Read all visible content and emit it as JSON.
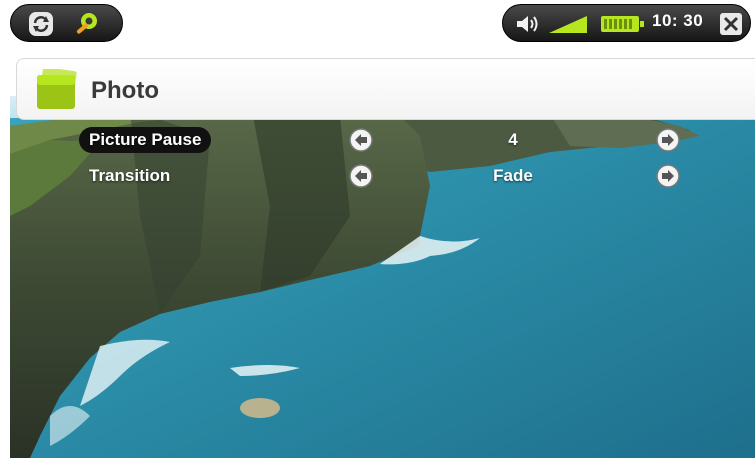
{
  "status": {
    "clock": "10: 30",
    "icons": [
      "volume-icon",
      "signal-icon",
      "battery-icon",
      "close-icon"
    ]
  },
  "toolbar": {
    "icons": [
      "refresh-icon",
      "settings-icon"
    ]
  },
  "header": {
    "title": "Photo",
    "icon": "photo-folder-icon"
  },
  "settings": [
    {
      "label": "Picture Pause",
      "value": "4",
      "selected": true
    },
    {
      "label": "Transition",
      "value": "Fade",
      "selected": false
    }
  ],
  "colors": {
    "accent_green": "#b6e61e",
    "pill_dark": "#222222",
    "sea": "#2e8fa5"
  }
}
